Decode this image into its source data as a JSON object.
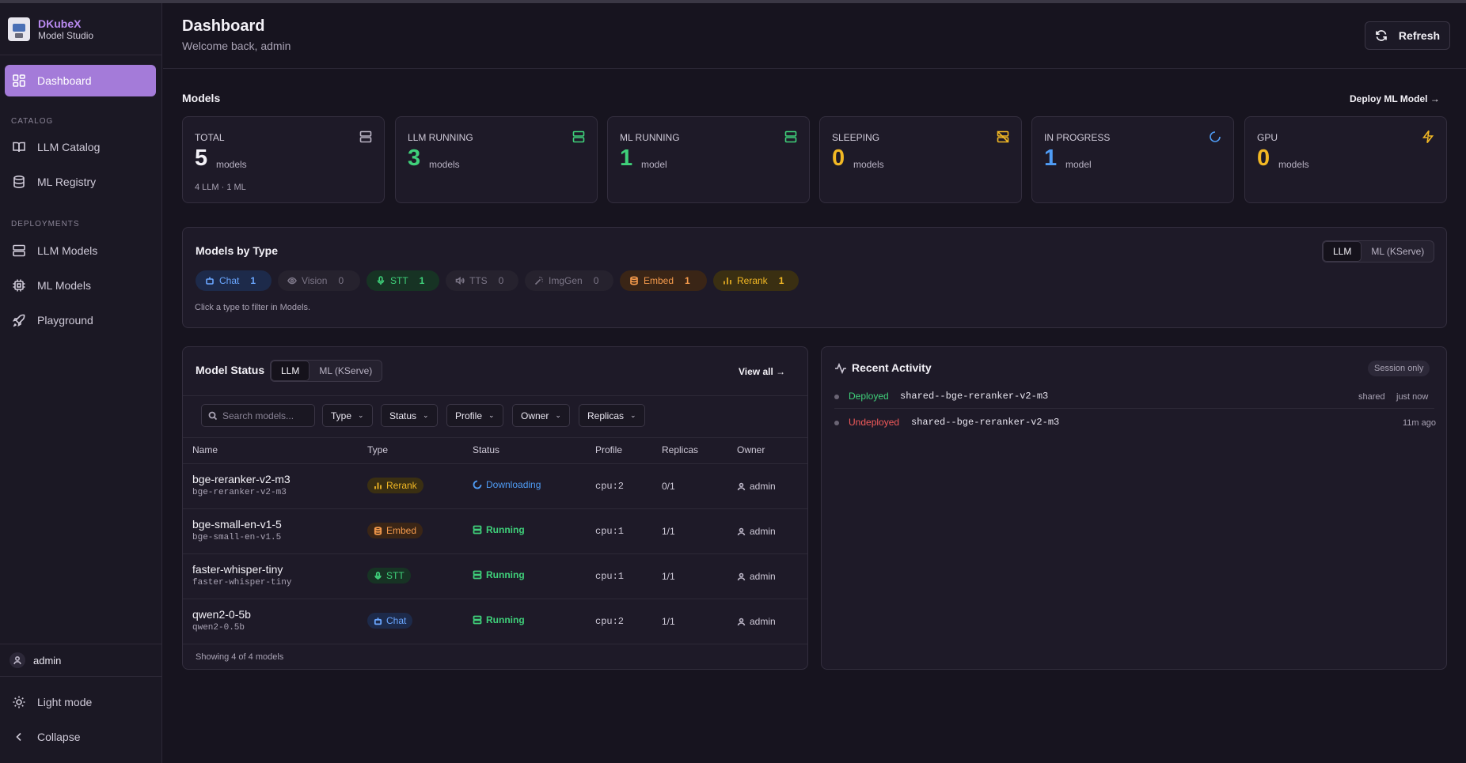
{
  "app": {
    "name": "DKubeX",
    "subtitle": "Model Studio"
  },
  "sidebar": {
    "dashboard": "Dashboard",
    "catalog_label": "CATALOG",
    "llm_catalog": "LLM Catalog",
    "ml_registry": "ML Registry",
    "deployments_label": "DEPLOYMENTS",
    "llm_models": "LLM Models",
    "ml_models": "ML Models",
    "playground": "Playground",
    "user": "admin",
    "light_mode": "Light mode",
    "collapse": "Collapse"
  },
  "header": {
    "title": "Dashboard",
    "subtitle": "Welcome back, admin",
    "refresh": "Refresh"
  },
  "models": {
    "title": "Models",
    "deploy_link": "Deploy ML Model →",
    "stats": [
      {
        "label": "TOTAL",
        "value": "5",
        "unit": "models",
        "foot": "4 LLM · 1 ML",
        "color": "#f3f1f7",
        "icon": "server-icon"
      },
      {
        "label": "LLM RUNNING",
        "value": "3",
        "unit": "models",
        "color": "#3fd07a",
        "icon": "server-icon"
      },
      {
        "label": "ML RUNNING",
        "value": "1",
        "unit": "model",
        "color": "#3fd07a",
        "icon": "server-icon"
      },
      {
        "label": "SLEEPING",
        "value": "0",
        "unit": "models",
        "color": "#f2b824",
        "icon": "server-off-icon"
      },
      {
        "label": "IN PROGRESS",
        "value": "1",
        "unit": "model",
        "color": "#4f9cf5",
        "icon": "spinner-icon"
      },
      {
        "label": "GPU",
        "value": "0",
        "unit": "models",
        "color": "#f2b824",
        "icon": "zap-icon"
      }
    ]
  },
  "by_type": {
    "title": "Models by Type",
    "toggle": [
      "LLM",
      "ML (KServe)"
    ],
    "chips": [
      {
        "label": "Chat",
        "count": "1"
      },
      {
        "label": "Vision",
        "count": "0"
      },
      {
        "label": "STT",
        "count": "1"
      },
      {
        "label": "TTS",
        "count": "0"
      },
      {
        "label": "ImgGen",
        "count": "0"
      },
      {
        "label": "Embed",
        "count": "1"
      },
      {
        "label": "Rerank",
        "count": "1"
      }
    ],
    "hint": "Click a type to filter in Models."
  },
  "model_status": {
    "title": "Model Status",
    "toggle": [
      "LLM",
      "ML (KServe)"
    ],
    "view_all": "View all →",
    "search_placeholder": "Search models...",
    "filters": [
      "Type",
      "Status",
      "Profile",
      "Owner",
      "Replicas"
    ],
    "columns": [
      "Name",
      "Type",
      "Status",
      "Profile",
      "Replicas",
      "Owner"
    ],
    "rows": [
      {
        "name": "bge-reranker-v2-m3",
        "sub": "bge-reranker-v2-m3",
        "type": "Rerank",
        "status": "Downloading",
        "profile": "cpu:2",
        "replicas": "0/1",
        "owner": "admin"
      },
      {
        "name": "bge-small-en-v1-5",
        "sub": "bge-small-en-v1.5",
        "type": "Embed",
        "status": "Running",
        "profile": "cpu:1",
        "replicas": "1/1",
        "owner": "admin"
      },
      {
        "name": "faster-whisper-tiny",
        "sub": "faster-whisper-tiny",
        "type": "STT",
        "status": "Running",
        "profile": "cpu:1",
        "replicas": "1/1",
        "owner": "admin"
      },
      {
        "name": "qwen2-0-5b",
        "sub": "qwen2-0.5b",
        "type": "Chat",
        "status": "Running",
        "profile": "cpu:2",
        "replicas": "1/1",
        "owner": "admin"
      }
    ],
    "footer": "Showing 4 of 4 models"
  },
  "activity": {
    "title": "Recent Activity",
    "badge": "Session only",
    "items": [
      {
        "action": "Deployed",
        "model": "shared--bge-reranker-v2-m3",
        "scope": "shared",
        "time": "just now"
      },
      {
        "action": "Undeployed",
        "model": "shared--bge-reranker-v2-m3",
        "scope": "",
        "time": "11m ago"
      }
    ]
  }
}
